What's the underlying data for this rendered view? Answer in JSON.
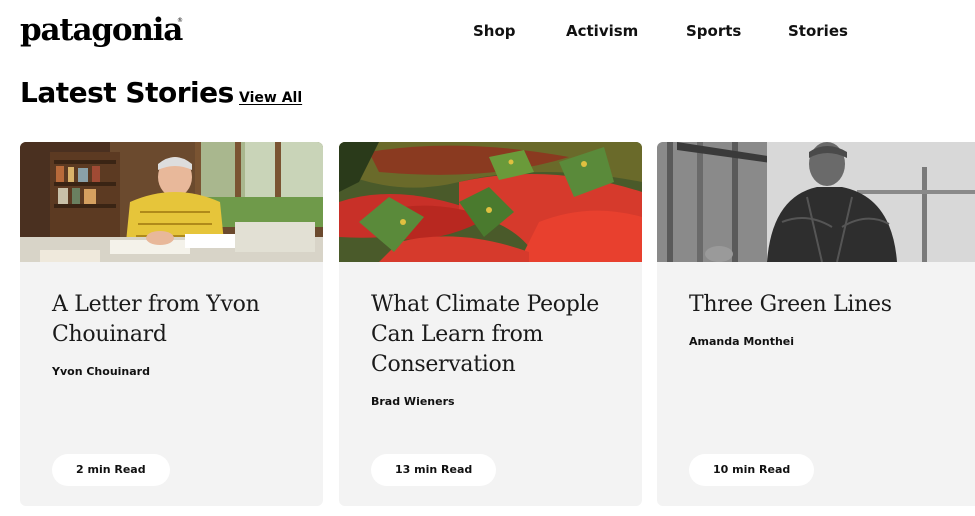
{
  "header": {
    "logo_text": "patagonia",
    "logo_reg": "®",
    "nav": [
      {
        "label": "Shop"
      },
      {
        "label": "Activism"
      },
      {
        "label": "Sports"
      },
      {
        "label": "Stories"
      }
    ]
  },
  "section": {
    "title": "Latest Stories",
    "view_all": "View All"
  },
  "cards": [
    {
      "image": "portrait-writing-letter",
      "title": "A Letter from Yvon Chouinard",
      "author": "Yvon Chouinard",
      "read_time": "2 min Read"
    },
    {
      "image": "red-salmon-school",
      "title": "What Climate People Can Learn from Conservation",
      "author": "Brad Wieners",
      "read_time": "13 min Read"
    },
    {
      "image": "black-white-portrait-man",
      "title": "Three Green Lines",
      "author": "Amanda Monthei",
      "read_time": "10 min Read"
    }
  ]
}
